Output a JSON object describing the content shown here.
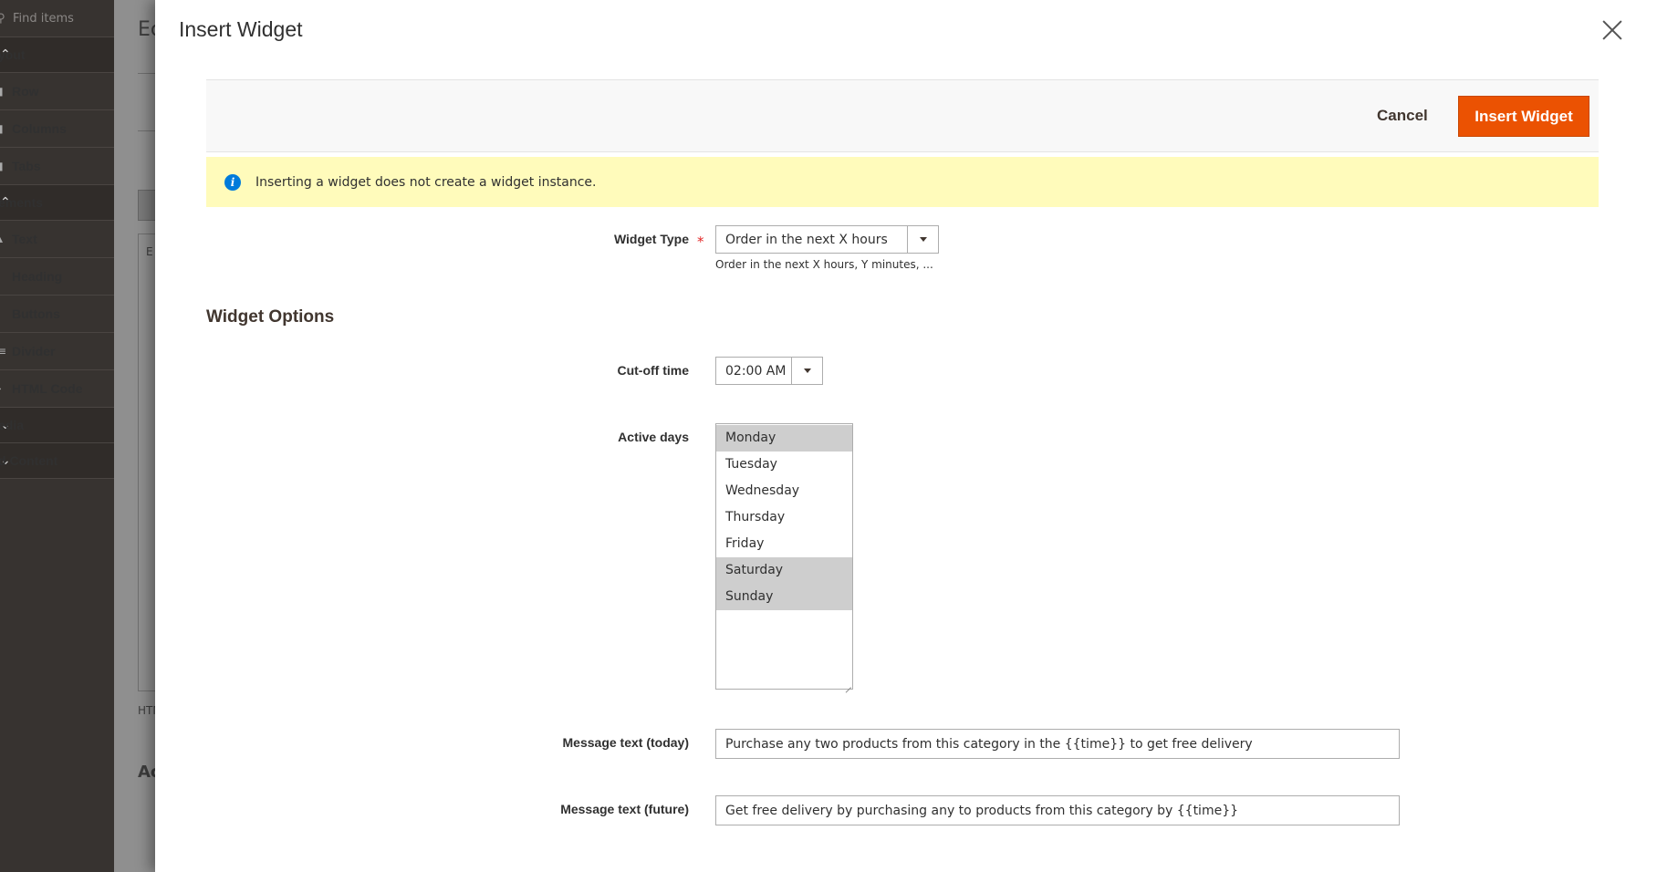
{
  "sidebar": {
    "search_placeholder": "Find items",
    "groups": [
      {
        "label": "yout",
        "items": [
          "Row",
          "Columns",
          "Tabs"
        ]
      },
      {
        "label": "ements",
        "items": [
          "Text",
          "Heading",
          "Buttons",
          "Divider",
          "HTML Code"
        ]
      }
    ],
    "collapsed_groups": [
      "edia",
      "d Content"
    ]
  },
  "background_page": {
    "title": "Ec",
    "editor_placeholder": "E",
    "html_label": "HTM",
    "section_title": "Ac"
  },
  "modal": {
    "title": "Insert Widget",
    "actions": {
      "cancel_label": "Cancel",
      "insert_label": "Insert Widget"
    },
    "notice": "Inserting a widget does not create a widget instance.",
    "widget_type": {
      "label": "Widget Type",
      "value": "Order in the next X hours",
      "note": "Order in the next X hours, Y minutes, ..."
    },
    "options_title": "Widget Options",
    "cutoff_time": {
      "label": "Cut-off time",
      "value": "02:00 AM"
    },
    "active_days": {
      "label": "Active days",
      "options": [
        {
          "label": "Monday",
          "selected": true
        },
        {
          "label": "Tuesday",
          "selected": false
        },
        {
          "label": "Wednesday",
          "selected": false
        },
        {
          "label": "Thursday",
          "selected": false
        },
        {
          "label": "Friday",
          "selected": false
        },
        {
          "label": "Saturday",
          "selected": true
        },
        {
          "label": "Sunday",
          "selected": true
        }
      ]
    },
    "message_today": {
      "label": "Message text (today)",
      "value": "Purchase any two products from this category in the {{time}} to get free delivery"
    },
    "message_future": {
      "label": "Message text (future)",
      "value": "Get free delivery by purchasing any to products from this category by {{time}}"
    }
  },
  "colors": {
    "primary_button": "#eb5202",
    "notice_bg": "#fffbbb",
    "info_icon": "#007bdb",
    "sidebar_bg": "#373330"
  }
}
